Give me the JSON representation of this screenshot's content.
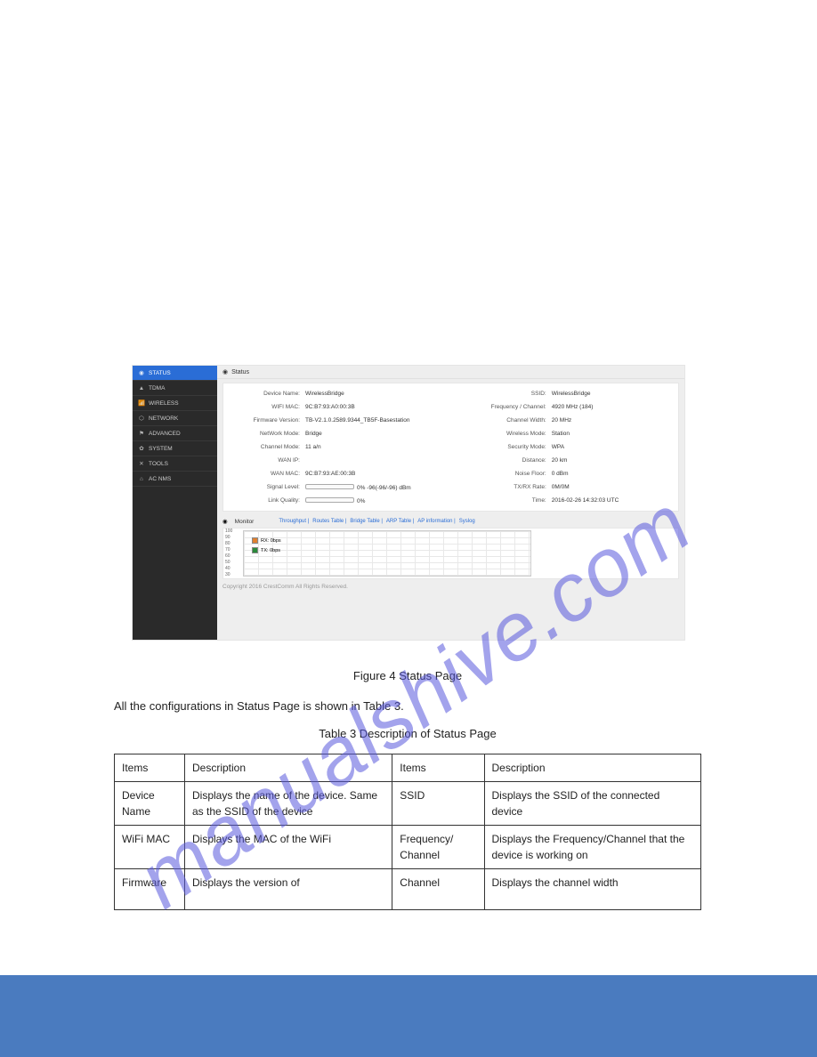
{
  "watermark": "manualshive.com",
  "screenshot": {
    "sidebar": [
      {
        "icon": "◉",
        "label": "STATUS",
        "active": true
      },
      {
        "icon": "▲",
        "label": "TDMA",
        "active": false
      },
      {
        "icon": "📶",
        "label": "WIRELESS",
        "active": false
      },
      {
        "icon": "⬡",
        "label": "NETWORK",
        "active": false
      },
      {
        "icon": "⚑",
        "label": "ADVANCED",
        "active": false
      },
      {
        "icon": "✿",
        "label": "SYSTEM",
        "active": false
      },
      {
        "icon": "✕",
        "label": "TOOLS",
        "active": false
      },
      {
        "icon": "⌂",
        "label": "AC NMS",
        "active": false
      }
    ],
    "statusTitle": "Status",
    "left": [
      {
        "label": "Device Name:",
        "value": "WirelessBridge"
      },
      {
        "label": "WIFI MAC:",
        "value": "9C:B7:93:A0:00:3B"
      },
      {
        "label": "Firmware Version:",
        "value": "TB-V2.1.0.2589.9344_TB5F-Basestation"
      },
      {
        "label": "NetWork Mode:",
        "value": "Bridge"
      },
      {
        "label": "Channel Mode:",
        "value": "11 a/n"
      },
      {
        "label": "WAN IP:",
        "value": ""
      },
      {
        "label": "WAN MAC:",
        "value": "9C:B7:93:AE:00:3B"
      },
      {
        "label": "Signal Level:",
        "value": "0%   -96(-96/-96) dBm",
        "bar": true
      },
      {
        "label": "Link Quality:",
        "value": "0%",
        "bar": true
      }
    ],
    "right": [
      {
        "label": "SSID:",
        "value": "WirelessBridge"
      },
      {
        "label": "Frequency / Channel:",
        "value": "4920 MHz (184)"
      },
      {
        "label": "Channel Width:",
        "value": "20 MHz"
      },
      {
        "label": "Wireless Mode:",
        "value": "Station"
      },
      {
        "label": "Security Mode:",
        "value": "WPA"
      },
      {
        "label": "Distance:",
        "value": "20 km"
      },
      {
        "label": "Noise Floor:",
        "value": "0 dBm"
      },
      {
        "label": "TX/RX Rate:",
        "value": "0M/0M"
      },
      {
        "label": "Time:",
        "value": "2016-02-26 14:32:03 UTC"
      }
    ],
    "monitorTitle": "Monitor",
    "monitorLinks": [
      "Throughput",
      "Routes Table",
      "Bridge Table",
      "ARP Table",
      "AP information",
      "Syslog"
    ],
    "yticks": [
      "100",
      "90",
      "80",
      "70",
      "60",
      "50",
      "40",
      "30"
    ],
    "legend": [
      {
        "class": "sw-orange",
        "text": "RX: 0bps"
      },
      {
        "class": "sw-green",
        "text": "TX: 0bps"
      }
    ],
    "copyright": "Copyright 2016 CrestComm All Rights Reserved."
  },
  "figureCaption": "Figure 4 Status Page",
  "para1": "All the configurations in Status Page is shown in Table 3.",
  "para2": "Table 3 Description of Status Page",
  "table": {
    "head": [
      "Items",
      "Description",
      "Items",
      "Description"
    ],
    "rows": [
      [
        "Device Name",
        "Displays the name of the device. Same as the SSID of the device",
        "SSID",
        "Displays the SSID of the connected device"
      ],
      [
        "WiFi MAC",
        "Displays the MAC of the WiFi",
        "Frequency/ Channel",
        "Displays the Frequency/Channel that the device is working on"
      ],
      [
        "Firmware",
        "Displays the version of",
        "Channel",
        "Displays the channel width"
      ]
    ]
  },
  "chart_data": {
    "type": "line",
    "title": "Throughput",
    "series": [
      {
        "name": "RX: 0bps",
        "values": []
      },
      {
        "name": "TX: 0bps",
        "values": []
      }
    ],
    "ylim": [
      30,
      100
    ],
    "ylabel": "",
    "xlabel": ""
  }
}
